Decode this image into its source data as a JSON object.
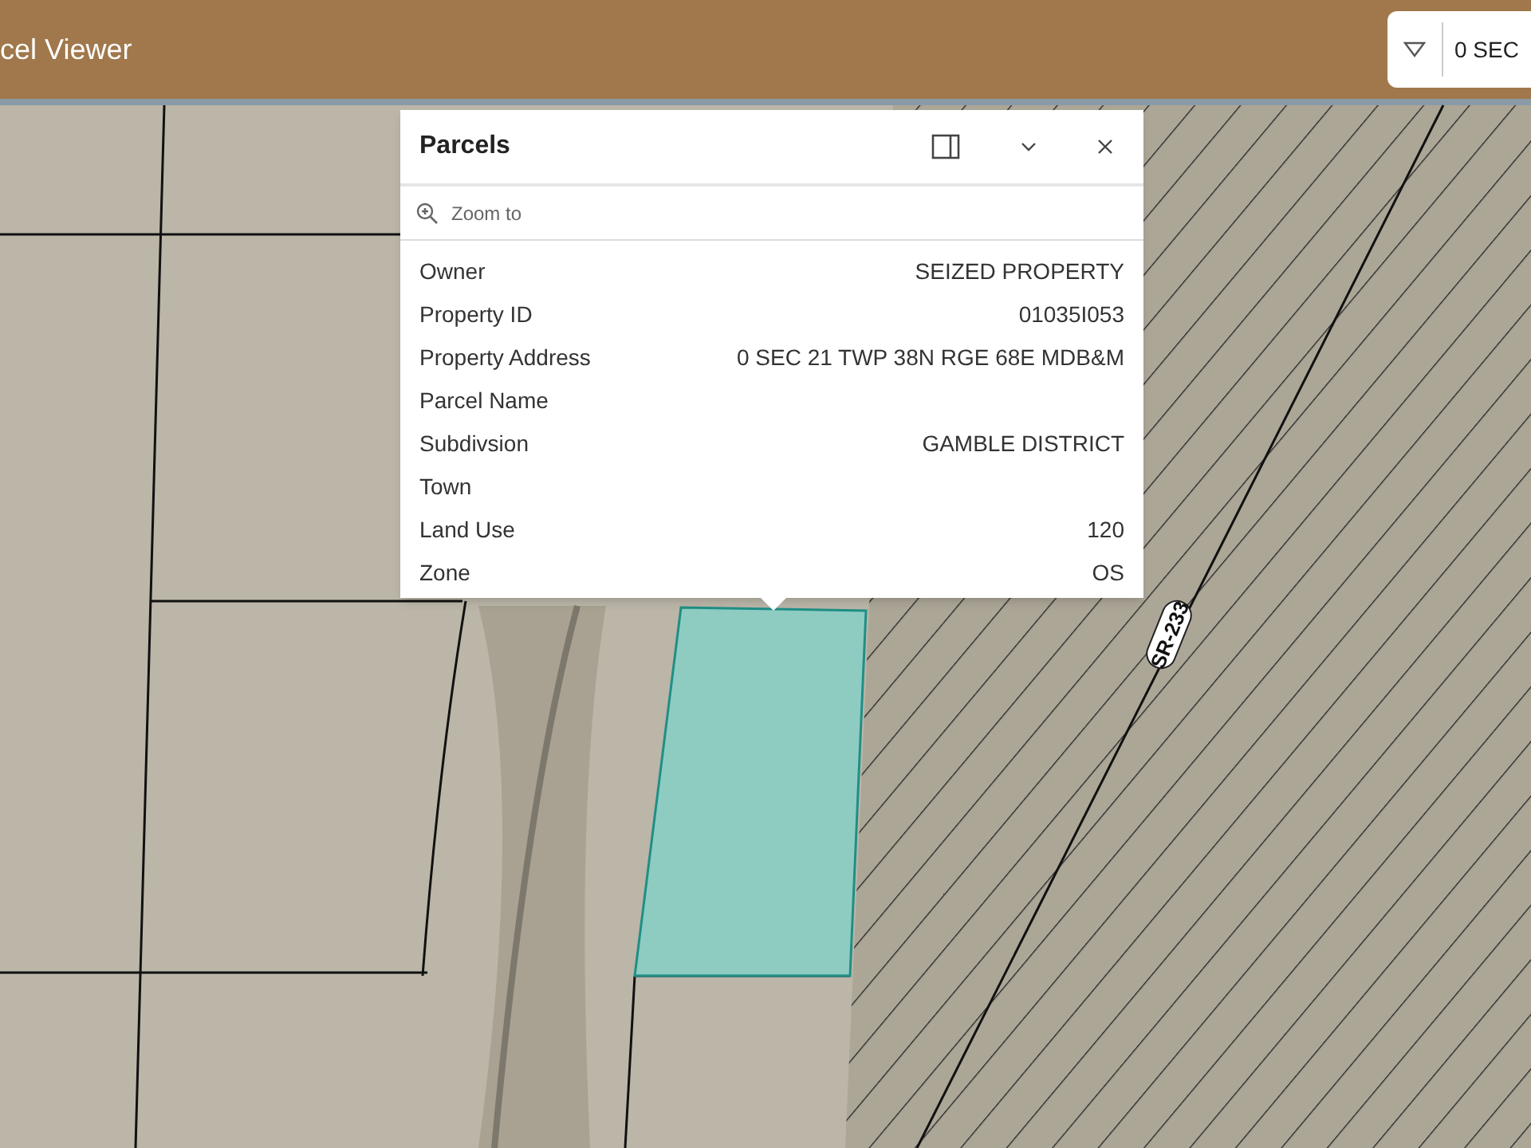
{
  "header": {
    "title": "cel Viewer",
    "search": {
      "value": "0 SEC"
    }
  },
  "popup": {
    "title": "Parcels",
    "action": "Zoom to",
    "fields": [
      {
        "label": "Owner",
        "value": "SEIZED PROPERTY"
      },
      {
        "label": "Property ID",
        "value": "01035I053"
      },
      {
        "label": "Property Address",
        "value": "0 SEC 21 TWP 38N RGE 68E MDB&M"
      },
      {
        "label": "Parcel Name"
      },
      {
        "label": "Subdivsion",
        "value": "GAMBLE DISTRICT"
      },
      {
        "label": "Town"
      },
      {
        "label": "Land Use",
        "value": "120"
      },
      {
        "label": "Zone",
        "value": "OS"
      }
    ]
  },
  "map": {
    "road_label": "SR-233"
  }
}
